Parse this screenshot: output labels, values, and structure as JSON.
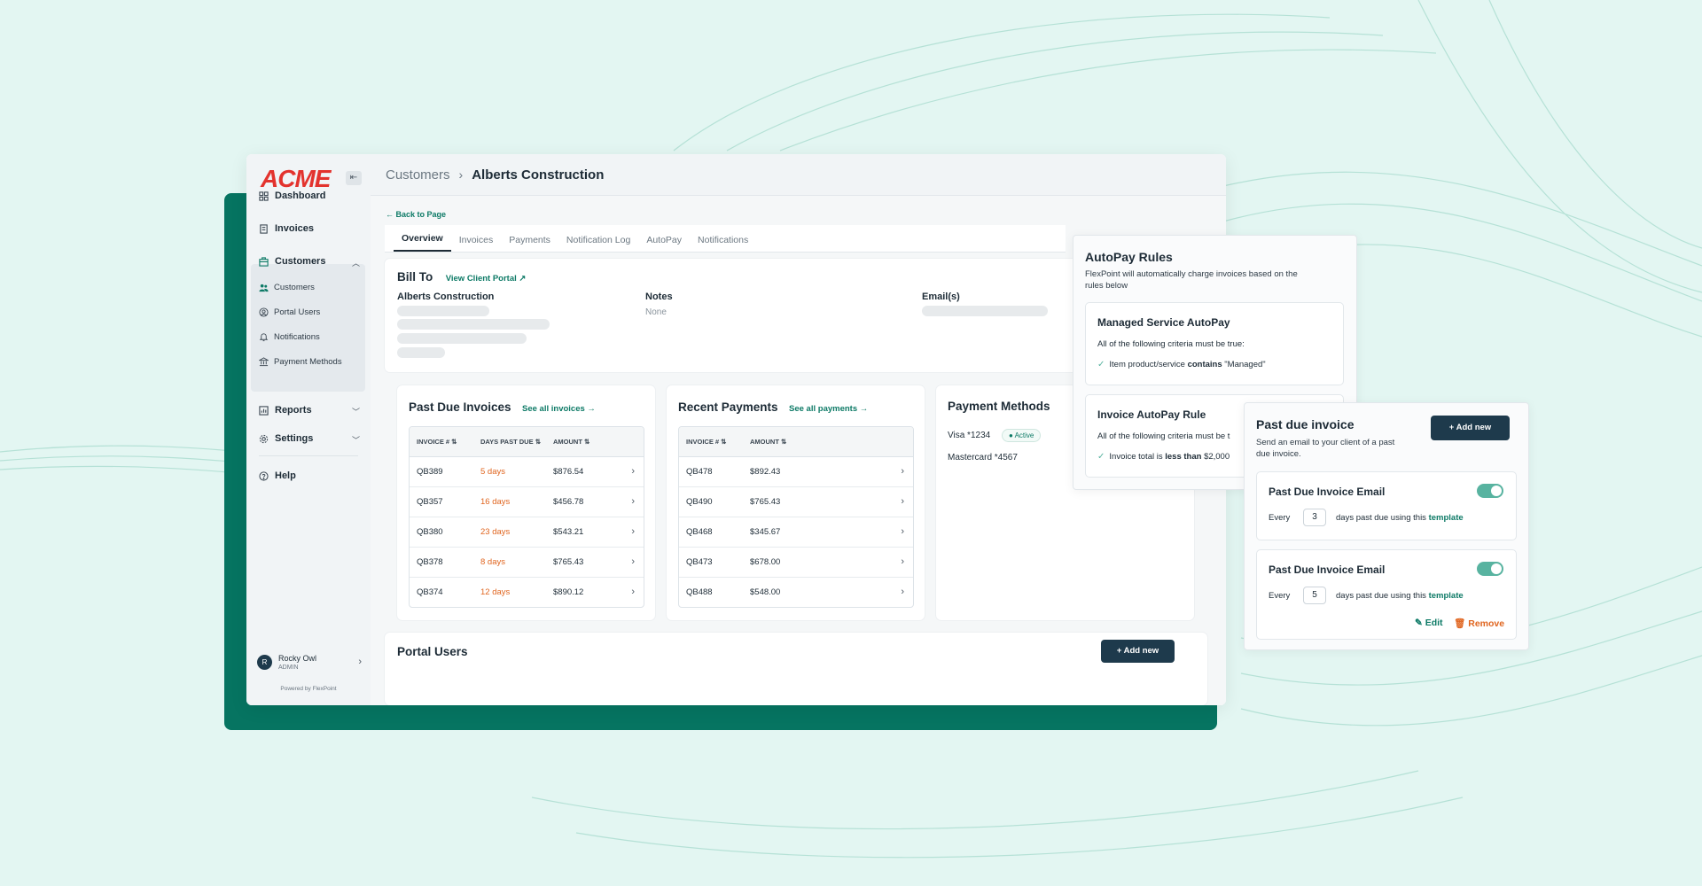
{
  "brand": {
    "logo": "ACME",
    "powered_by": "Powered by FlexPoint"
  },
  "sidebar": {
    "items": [
      {
        "label": "Dashboard",
        "icon": "dashboard-icon"
      },
      {
        "label": "Invoices",
        "icon": "invoice-icon"
      },
      {
        "label": "Customers",
        "icon": "briefcase-icon"
      },
      {
        "label": "Reports",
        "icon": "report-icon"
      },
      {
        "label": "Settings",
        "icon": "gear-icon"
      },
      {
        "label": "Help",
        "icon": "help-icon"
      }
    ],
    "sub_items": [
      {
        "label": "Customers",
        "icon": "users-icon"
      },
      {
        "label": "Portal Users",
        "icon": "user-circle-icon"
      },
      {
        "label": "Notifications",
        "icon": "bell-icon"
      },
      {
        "label": "Payment Methods",
        "icon": "bank-icon"
      }
    ],
    "user": {
      "initial": "R",
      "name": "Rocky Owl",
      "role": "ADMIN"
    }
  },
  "header": {
    "breadcrumb_parent": "Customers",
    "breadcrumb_current": "Alberts Construction",
    "separator": "›"
  },
  "back_link": "← Back to Page",
  "tabs": [
    "Overview",
    "Invoices",
    "Payments",
    "Notification Log",
    "AutoPay",
    "Notifications"
  ],
  "bill_to": {
    "title": "Bill To",
    "portal_link": "View Client Portal ↗",
    "company": "Alberts Construction",
    "notes_label": "Notes",
    "notes_value": "None",
    "emails_label": "Email(s)"
  },
  "past_due": {
    "title": "Past Due Invoices",
    "link": "See all invoices →",
    "headers": [
      "INVOICE #",
      "DAYS PAST DUE",
      "AMOUNT"
    ],
    "rows": [
      {
        "invoice": "QB389",
        "days": "5 days",
        "amount": "$876.54"
      },
      {
        "invoice": "QB357",
        "days": "16 days",
        "amount": "$456.78"
      },
      {
        "invoice": "QB380",
        "days": "23 days",
        "amount": "$543.21"
      },
      {
        "invoice": "QB378",
        "days": "8 days",
        "amount": "$765.43"
      },
      {
        "invoice": "QB374",
        "days": "12 days",
        "amount": "$890.12"
      }
    ]
  },
  "recent_payments": {
    "title": "Recent Payments",
    "link": "See all payments →",
    "headers": [
      "INVOICE #",
      "AMOUNT"
    ],
    "rows": [
      {
        "invoice": "QB478",
        "amount": "$892.43"
      },
      {
        "invoice": "QB490",
        "amount": "$765.43"
      },
      {
        "invoice": "QB468",
        "amount": "$345.67"
      },
      {
        "invoice": "QB473",
        "amount": "$678.00"
      },
      {
        "invoice": "QB488",
        "amount": "$548.00"
      }
    ]
  },
  "payment_methods": {
    "title": "Payment Methods",
    "methods": [
      "Visa *1234",
      "Mastercard *4567"
    ],
    "active_badge": "● Active"
  },
  "portal_users": {
    "title": "Portal Users",
    "add_label": "+  Add new"
  },
  "autopay": {
    "title": "AutoPay Rules",
    "description": "FlexPoint will automatically charge invoices based on the rules below",
    "rules": [
      {
        "title": "Managed Service AutoPay",
        "criteria_intro": "All of the following criteria must be true:",
        "criteria_prefix": "Item product/service",
        "criteria_op": "contains",
        "criteria_value": "\"Managed\""
      },
      {
        "title": "Invoice AutoPay Rule",
        "criteria_intro": "All of the following criteria must be t",
        "criteria_prefix": "Invoice total is",
        "criteria_op": "less than",
        "criteria_value": "$2,000"
      }
    ]
  },
  "past_due_panel": {
    "title": "Past due invoice",
    "description": "Send an email to your client of a past due invoice.",
    "add_label": "+  Add new",
    "emails": [
      {
        "title": "Past Due Invoice Email",
        "every": "Every",
        "days": "3",
        "suffix": "days past due using this",
        "link": "template"
      },
      {
        "title": "Past Due Invoice Email",
        "every": "Every",
        "days": "5",
        "suffix": "days past due using this",
        "link": "template"
      }
    ],
    "edit_label": "✎ Edit",
    "remove_label": "🗑 Remove"
  },
  "colors": {
    "accent": "#0d7a66",
    "dark": "#1e3a4c",
    "brand_red": "#e3332e",
    "warning": "#e0651f",
    "background": "#e3f6f2",
    "slab": "#067461"
  }
}
